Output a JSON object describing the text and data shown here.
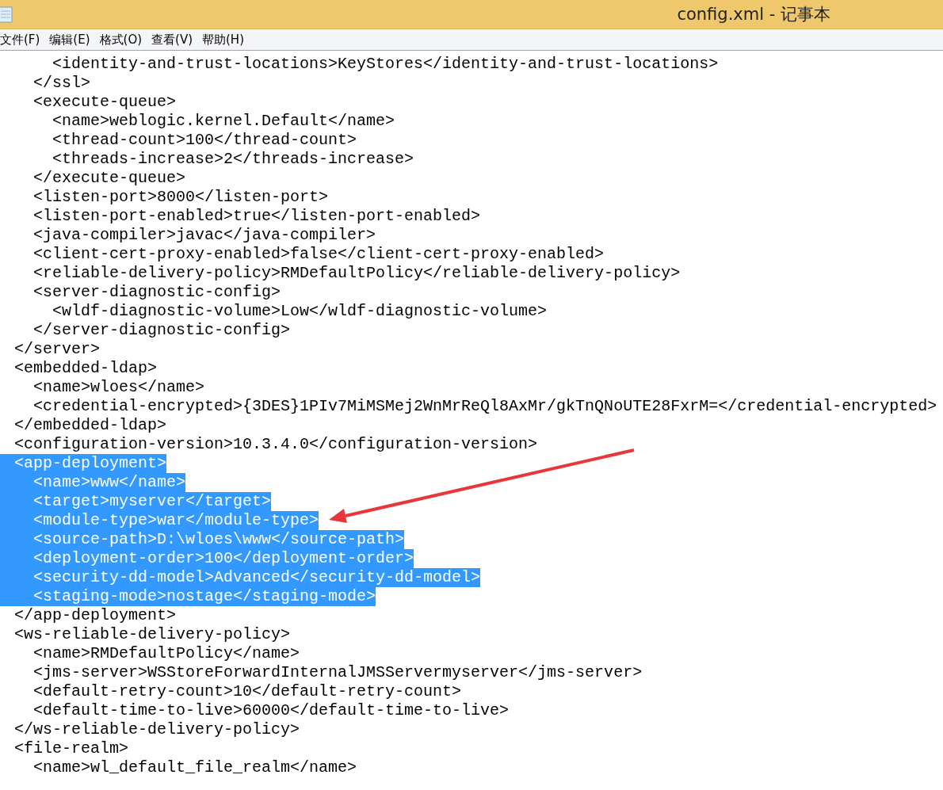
{
  "window": {
    "title": "config.xml - 记事本"
  },
  "menu": [
    "文件(F)",
    "编辑(E)",
    "格式(O)",
    "查看(V)",
    "帮助(H)"
  ],
  "editor": {
    "lines": [
      {
        "text": "     <identity-and-trust-locations>KeyStores</identity-and-trust-locations>",
        "selected": false
      },
      {
        "text": "   </ssl>",
        "selected": false
      },
      {
        "text": "   <execute-queue>",
        "selected": false
      },
      {
        "text": "     <name>weblogic.kernel.Default</name>",
        "selected": false
      },
      {
        "text": "     <thread-count>100</thread-count>",
        "selected": false
      },
      {
        "text": "     <threads-increase>2</threads-increase>",
        "selected": false
      },
      {
        "text": "   </execute-queue>",
        "selected": false
      },
      {
        "text": "   <listen-port>8000</listen-port>",
        "selected": false
      },
      {
        "text": "   <listen-port-enabled>true</listen-port-enabled>",
        "selected": false
      },
      {
        "text": "   <java-compiler>javac</java-compiler>",
        "selected": false
      },
      {
        "text": "   <client-cert-proxy-enabled>false</client-cert-proxy-enabled>",
        "selected": false
      },
      {
        "text": "   <reliable-delivery-policy>RMDefaultPolicy</reliable-delivery-policy>",
        "selected": false
      },
      {
        "text": "   <server-diagnostic-config>",
        "selected": false
      },
      {
        "text": "     <wldf-diagnostic-volume>Low</wldf-diagnostic-volume>",
        "selected": false
      },
      {
        "text": "   </server-diagnostic-config>",
        "selected": false
      },
      {
        "text": " </server>",
        "selected": false
      },
      {
        "text": " <embedded-ldap>",
        "selected": false
      },
      {
        "text": "   <name>wloes</name>",
        "selected": false
      },
      {
        "text": "   <credential-encrypted>{3DES}1PIv7MiMSMej2WnMrReQl8AxMr/gkTnQNoUTE28FxrM=</credential-encrypted>",
        "selected": false
      },
      {
        "text": " </embedded-ldap>",
        "selected": false
      },
      {
        "text": " <configuration-version>10.3.4.0</configuration-version>",
        "selected": false
      },
      {
        "text": " <app-deployment>",
        "selected": true
      },
      {
        "text": "   <name>www</name>",
        "selected": true
      },
      {
        "text": "   <target>myserver</target>",
        "selected": true
      },
      {
        "text": "   <module-type>war</module-type>",
        "selected": true
      },
      {
        "text": "   <source-path>D:\\wloes\\www</source-path>",
        "selected": true
      },
      {
        "text": "   <deployment-order>100</deployment-order>",
        "selected": true
      },
      {
        "text": "   <security-dd-model>Advanced</security-dd-model>",
        "selected": true
      },
      {
        "text": "   <staging-mode>nostage</staging-mode>",
        "selected": true
      },
      {
        "text": " </app-deployment>",
        "selected": false
      },
      {
        "text": " <ws-reliable-delivery-policy>",
        "selected": false
      },
      {
        "text": "   <name>RMDefaultPolicy</name>",
        "selected": false
      },
      {
        "text": "   <jms-server>WSStoreForwardInternalJMSServermyserver</jms-server>",
        "selected": false
      },
      {
        "text": "   <default-retry-count>10</default-retry-count>",
        "selected": false
      },
      {
        "text": "   <default-time-to-live>60000</default-time-to-live>",
        "selected": false
      },
      {
        "text": " </ws-reliable-delivery-policy>",
        "selected": false
      },
      {
        "text": " <file-realm>",
        "selected": false
      },
      {
        "text": "   <name>wl_default_file_realm</name>",
        "selected": false
      }
    ]
  }
}
